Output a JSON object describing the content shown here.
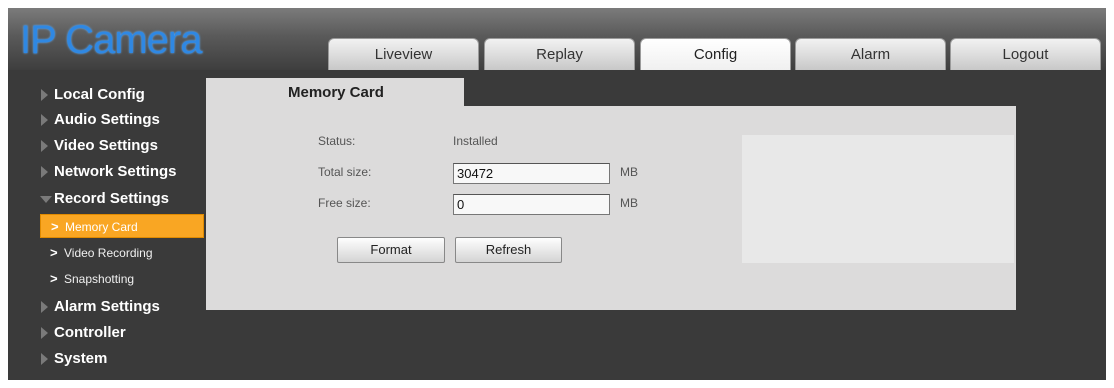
{
  "header": {
    "logo": "IP Camera",
    "tabs": [
      {
        "label": "Liveview"
      },
      {
        "label": "Replay"
      },
      {
        "label": "Config"
      },
      {
        "label": "Alarm"
      },
      {
        "label": "Logout"
      }
    ],
    "active_tab": "Config"
  },
  "sidebar": {
    "items": [
      {
        "label": "Local Config"
      },
      {
        "label": "Audio Settings"
      },
      {
        "label": "Video Settings"
      },
      {
        "label": "Network Settings"
      },
      {
        "label": "Record Settings",
        "expanded": true
      },
      {
        "label": "Alarm Settings"
      },
      {
        "label": "Controller"
      },
      {
        "label": "System"
      }
    ],
    "sub_items": [
      {
        "label": "Memory Card",
        "active": true
      },
      {
        "label": "Video Recording"
      },
      {
        "label": "Snapshotting"
      }
    ]
  },
  "panel": {
    "title": "Memory Card",
    "status_label": "Status:",
    "status_value": "Installed",
    "total_label": "Total size:",
    "total_value": "30472",
    "total_unit": "MB",
    "free_label": "Free size:",
    "free_value": "0",
    "free_unit": "MB",
    "format_button": "Format",
    "refresh_button": "Refresh"
  },
  "colors": {
    "accent": "#f9a623",
    "logo": "#2f88e3",
    "background_dark": "#3a3a3a",
    "panel": "#dcdbdb"
  }
}
